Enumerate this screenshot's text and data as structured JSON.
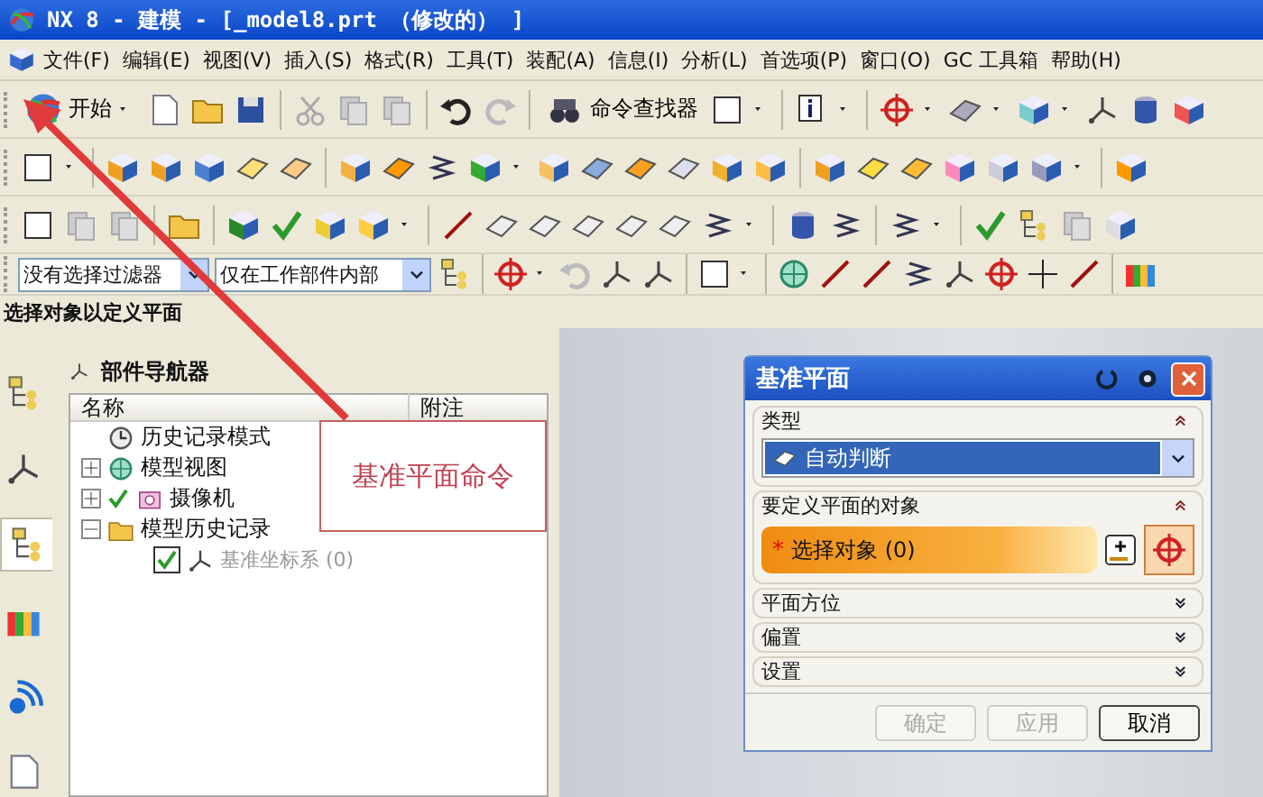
{
  "window": {
    "title": "NX 8 - 建模 - [_model8.prt （修改的） ]"
  },
  "menu": [
    "文件(F)",
    "编辑(E)",
    "视图(V)",
    "插入(S)",
    "格式(R)",
    "工具(T)",
    "装配(A)",
    "信息(I)",
    "分析(L)",
    "首选项(P)",
    "窗口(O)",
    "GC 工具箱",
    "帮助(H)"
  ],
  "toolbar": {
    "start_label": "开始",
    "command_finder": "命令查找器"
  },
  "filters": [
    {
      "value": "没有选择过滤器"
    },
    {
      "value": "仅在工作部件内部"
    }
  ],
  "cue_line": "选择对象以定义平面",
  "resource_tabs": [
    {
      "selected": false
    },
    {
      "selected": false
    },
    {
      "selected": true
    },
    {
      "selected": false
    },
    {
      "selected": false
    },
    {
      "selected": false
    }
  ],
  "part_navigator": {
    "title": "部件导航器",
    "columns": [
      "名称",
      "附注"
    ],
    "tree": [
      {
        "kind": "mode",
        "label": "历史记录模式",
        "checked": false,
        "dimmed": false
      },
      {
        "kind": "group",
        "label": "模型视图",
        "expanded": false,
        "checked": false,
        "dimmed": false
      },
      {
        "kind": "camera",
        "label": "摄像机",
        "expanded": false,
        "checked": true,
        "dimmed": false
      },
      {
        "kind": "folder",
        "label": "模型历史记录",
        "expanded": true,
        "checked": false,
        "dimmed": false,
        "children": [
          {
            "kind": "csys",
            "label": "基准坐标系 (0)",
            "checked": true,
            "dimmed": true
          }
        ]
      }
    ]
  },
  "annotation": {
    "text": "基准平面命令"
  },
  "dialog": {
    "title": "基准平面",
    "sections": [
      {
        "kind": "dropdown",
        "title": "类型",
        "expanded": true,
        "value": "自动判断"
      },
      {
        "kind": "selection",
        "title": "要定义平面的对象",
        "expanded": true,
        "required_mark": "*",
        "label": "选择对象 (0)"
      },
      {
        "kind": "plain",
        "title": "平面方位",
        "expanded": false
      },
      {
        "kind": "plain",
        "title": "偏置",
        "expanded": false
      },
      {
        "kind": "plain",
        "title": "设置",
        "expanded": false
      }
    ],
    "buttons": [
      {
        "label": "确定",
        "disabled": true
      },
      {
        "label": "应用",
        "disabled": true
      },
      {
        "label": "取消",
        "disabled": false
      }
    ]
  }
}
